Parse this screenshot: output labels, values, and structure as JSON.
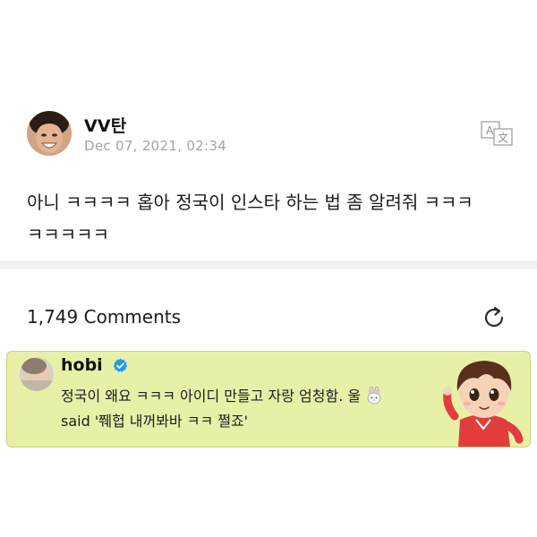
{
  "post": {
    "author": "VV탄",
    "date": "Dec 07, 2021, 02:34",
    "body": "아니 ㅋㅋㅋㅋ 홉아 정국이 인스타 하는 법 좀 알려줘 ㅋㅋㅋ ㅋㅋㅋㅋㅋ",
    "translate_icon": "translate-icon"
  },
  "comments": {
    "count_label": "1,749 Comments",
    "refresh_icon": "refresh-icon",
    "items": [
      {
        "author": "hobi",
        "verified": true,
        "text_line1": "정국이 왜요 ㅋㅋㅋ 아이디 만들고 자랑 엄청함. 울",
        "text_line2": "said '쮀헙 내꺼봐바 ㅋㅋ 쩔죠'",
        "emoji": "rabbit-emoji",
        "sticker": "character-sticker"
      }
    ]
  },
  "colors": {
    "highlight_background": "#e8f0a8",
    "verified_blue": "#1d9bf0",
    "date_gray": "#a3a3a8",
    "divider": "#f1f2f6"
  }
}
